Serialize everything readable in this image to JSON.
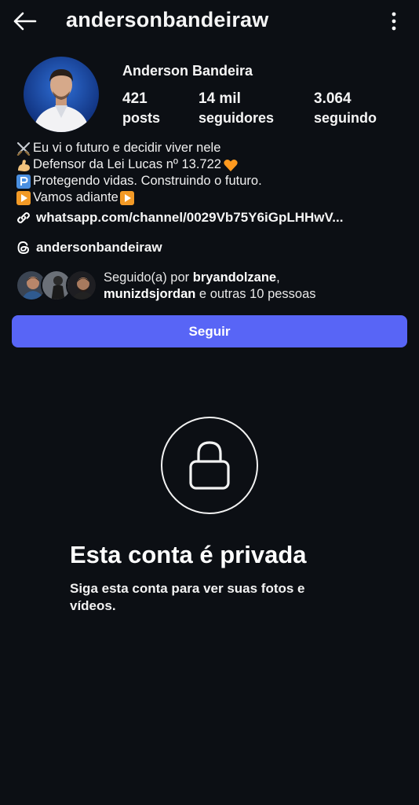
{
  "header": {
    "username": "andersonbandeiraw",
    "back_icon": "arrow-left-icon",
    "more_icon": "more-vertical-icon"
  },
  "profile": {
    "full_name": "Anderson Bandeira",
    "stats": [
      {
        "value": "421",
        "label": "posts"
      },
      {
        "value": "14 mil",
        "label": "seguidores"
      },
      {
        "value": "3.064",
        "label": "seguindo"
      }
    ]
  },
  "bio": {
    "lines": [
      {
        "icon": "crossed-swords-emoji",
        "text": "Eu vi o futuro e decidir viver nele"
      },
      {
        "icon": "flexed-biceps-emoji",
        "text": "Defensor da Lei Lucas nº 13.722 ",
        "trailing_icon": "orange-heart-emoji"
      },
      {
        "icon": "parking-p-emoji",
        "text": "Protegendo vidas. Construindo o futuro."
      },
      {
        "icon": "play-button-emoji",
        "text": "Vamos adiante",
        "trailing_icon": "play-button-emoji"
      }
    ],
    "link": "whatsapp.com/channel/0029Vb75Y6iGpLHHwV...",
    "threads_handle": "andersonbandeiraw"
  },
  "followed_by": {
    "prefix": "Seguido(a) por ",
    "user1": "bryandolzane",
    "separator": ",",
    "user2": "munizdsjordan",
    "suffix": " e outras 10 pessoas"
  },
  "follow_button": {
    "label": "Seguir"
  },
  "private": {
    "title": "Esta conta é privada",
    "subtitle": "Siga esta conta para ver suas fotos e vídeos."
  },
  "colors": {
    "background": "#0c0f14",
    "accent": "#5865f6",
    "heart": "#ff9a1f"
  }
}
